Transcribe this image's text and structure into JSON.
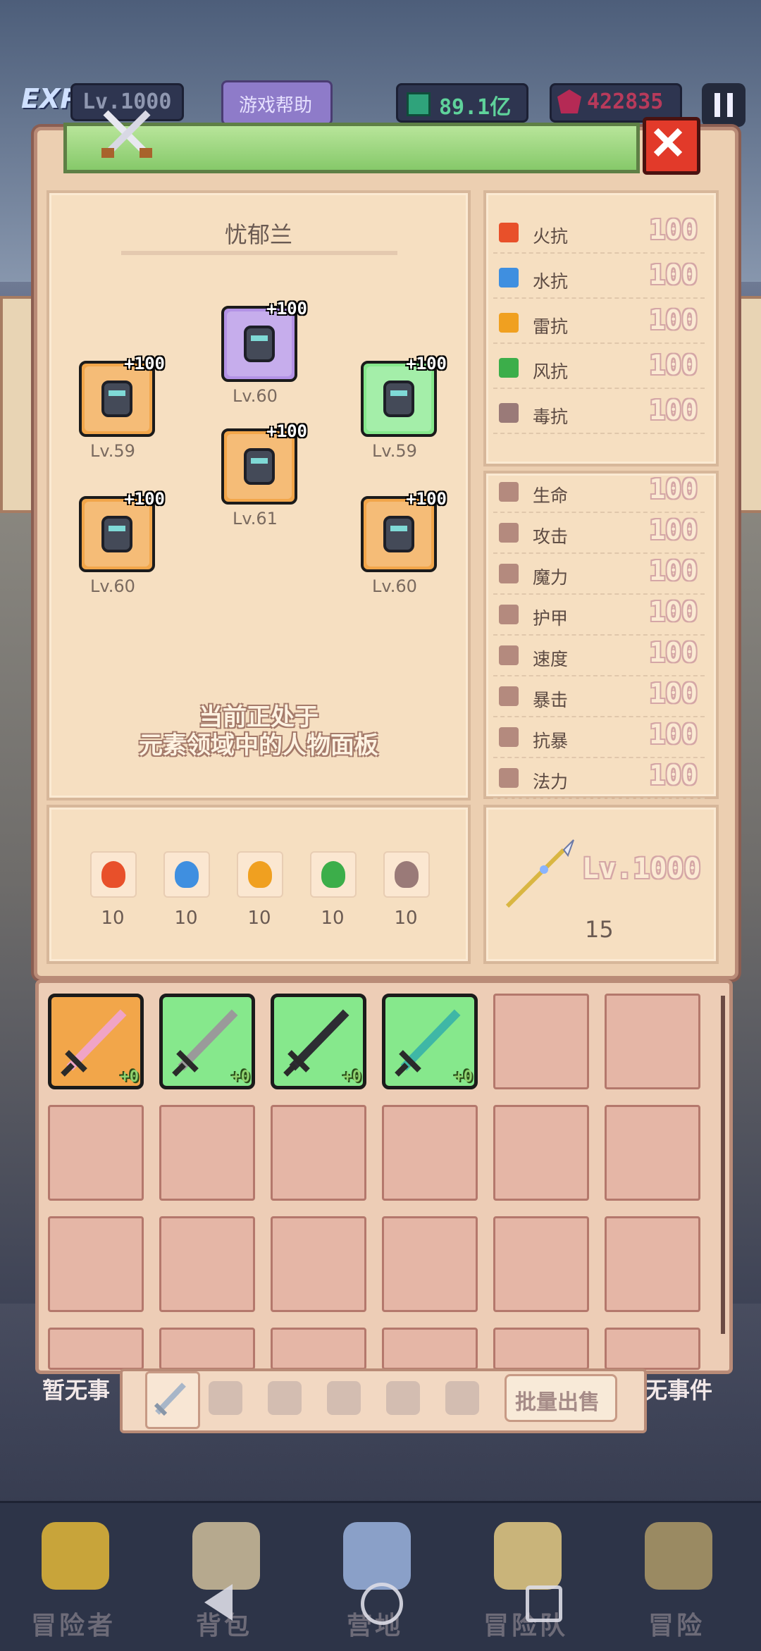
{
  "hud": {
    "exp_label": "EXP",
    "level_text": "Lv.1000",
    "help_button": "游戏帮助",
    "emerald_value": "89.1亿",
    "ruby_value": "422835",
    "pause_icon": "pause-icon"
  },
  "panel": {
    "character_name": "忧郁兰",
    "close_icon": "close-icon",
    "crossed_swords_icon": "crossed-swords-icon",
    "info_line1": "当前正处于",
    "info_line2": "元素领域中的人物面板"
  },
  "equipment": [
    {
      "slot": "helmet",
      "plus": "+100",
      "level": "Lv.60",
      "rarity": "purple",
      "icon": "helmet-icon"
    },
    {
      "slot": "weapon",
      "plus": "+100",
      "level": "Lv.59",
      "rarity": "orange",
      "icon": "ice-sword-icon"
    },
    {
      "slot": "shield",
      "plus": "+100",
      "level": "Lv.59",
      "rarity": "green",
      "icon": "shield-icon"
    },
    {
      "slot": "armor",
      "plus": "+100",
      "level": "Lv.61",
      "rarity": "orange",
      "icon": "armor-icon"
    },
    {
      "slot": "ring",
      "plus": "+100",
      "level": "Lv.60",
      "rarity": "orange",
      "icon": "ring-icon"
    },
    {
      "slot": "boots",
      "plus": "+100",
      "level": "Lv.60",
      "rarity": "orange",
      "icon": "boots-icon"
    }
  ],
  "resistances": [
    {
      "name": "火抗",
      "value": "100",
      "icon": "fire-icon",
      "color": "#e8502a"
    },
    {
      "name": "水抗",
      "value": "100",
      "icon": "water-icon",
      "color": "#3f8fe0"
    },
    {
      "name": "雷抗",
      "value": "100",
      "icon": "lightning-icon",
      "color": "#f0a020"
    },
    {
      "name": "风抗",
      "value": "100",
      "icon": "wind-icon",
      "color": "#3cae4a"
    },
    {
      "name": "毒抗",
      "value": "100",
      "icon": "poison-skull-icon",
      "color": "#9a7a78"
    }
  ],
  "attributes": [
    {
      "name": "生命",
      "value": "100",
      "icon": "heart-icon"
    },
    {
      "name": "攻击",
      "value": "100",
      "icon": "sword-icon"
    },
    {
      "name": "魔力",
      "value": "100",
      "icon": "staff-icon"
    },
    {
      "name": "护甲",
      "value": "100",
      "icon": "armor-stat-icon"
    },
    {
      "name": "速度",
      "value": "100",
      "icon": "boot-icon"
    },
    {
      "name": "暴击",
      "value": "100",
      "icon": "crit-icon"
    },
    {
      "name": "抗暴",
      "value": "100",
      "icon": "anti-crit-icon"
    },
    {
      "name": "法力",
      "value": "100",
      "icon": "mana-icon"
    }
  ],
  "elements": [
    {
      "value": "10",
      "icon": "fire-element-icon",
      "color": "#e8502a"
    },
    {
      "value": "10",
      "icon": "water-element-icon",
      "color": "#3f8fe0"
    },
    {
      "value": "10",
      "icon": "lightning-element-icon",
      "color": "#f0a020"
    },
    {
      "value": "10",
      "icon": "wind-element-icon",
      "color": "#3cae4a"
    },
    {
      "value": "10",
      "icon": "poison-element-icon",
      "color": "#9a7a78"
    }
  ],
  "weapon_panel": {
    "icon": "spear-icon",
    "level": "Lv.1000",
    "count": "15"
  },
  "inventory": {
    "items": [
      {
        "plus": "+0",
        "rarity": "orange",
        "icon": "pink-sword-icon"
      },
      {
        "plus": "+0",
        "rarity": "green",
        "icon": "iron-sword-icon"
      },
      {
        "plus": "+0",
        "rarity": "green",
        "icon": "dark-sword-icon"
      },
      {
        "plus": "+0",
        "rarity": "green",
        "icon": "teal-sword-icon"
      }
    ],
    "bulk_sell_button": "批量出售",
    "tab_icons": [
      "weapon-tab-icon",
      "shield-tab-icon",
      "helmet-tab-icon",
      "armor-tab-icon",
      "pants-tab-icon",
      "ring-tab-icon"
    ]
  },
  "background": {
    "left_event": "暂无事",
    "right_event": "无事件"
  },
  "bottom_nav": [
    {
      "label": "冒险者",
      "icon": "adventurer-icon"
    },
    {
      "label": "背包",
      "icon": "backpack-icon"
    },
    {
      "label": "营地",
      "icon": "camp-icon"
    },
    {
      "label": "冒险队",
      "icon": "team-icon"
    },
    {
      "label": "冒险",
      "icon": "adventure-icon"
    }
  ],
  "colors": {
    "orange_rarity": "#f2a64a",
    "green_rarity": "#86e88c",
    "purple_rarity": "#b392e6",
    "panel_bg": "#f6dfc1",
    "value_pink": "#d4a6a6"
  }
}
